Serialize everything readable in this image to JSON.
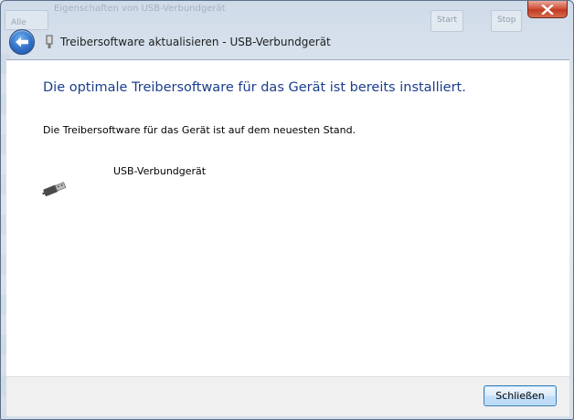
{
  "background_window": {
    "title": "Eigenschaften von USB-Verbundgerät",
    "left_button": "Alle",
    "right_button_1": "Start",
    "right_button_2": "Stop"
  },
  "window": {
    "title": "Treibersoftware aktualisieren - USB-Verbundgerät",
    "close_icon": "close-x-icon",
    "back_icon": "back-arrow-icon"
  },
  "content": {
    "heading": "Die optimale Treibersoftware für das Gerät ist bereits installiert.",
    "status_text": "Die Treibersoftware für das Gerät ist auf dem neuesten Stand.",
    "device_name": "USB-Verbundgerät",
    "device_icon": "usb-plug-icon"
  },
  "footer": {
    "close_button_label": "Schließen"
  },
  "colors": {
    "heading": "#1a3e8c",
    "close_button_red": "#c03a23",
    "back_button_blue": "#2f6fc6"
  }
}
